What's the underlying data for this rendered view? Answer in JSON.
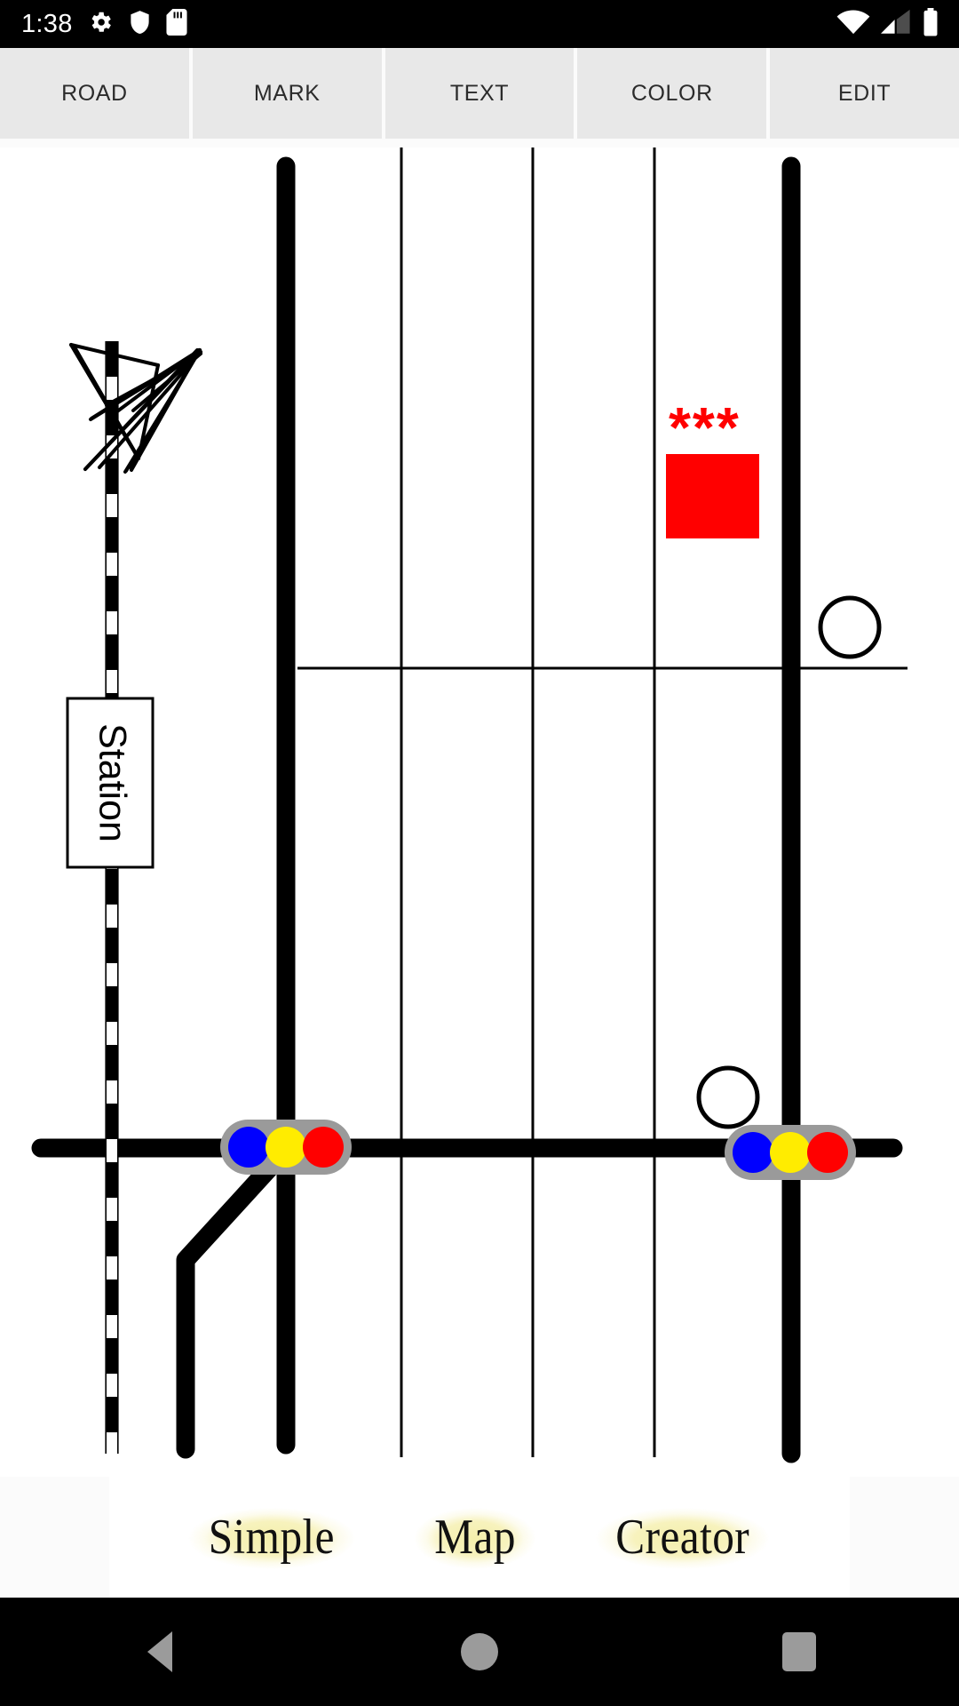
{
  "status_bar": {
    "time": "1:38",
    "left_icons": [
      "gear-icon",
      "shield-icon",
      "sd-card-icon"
    ],
    "right_icons": [
      "wifi-icon",
      "cellular-signal-icon",
      "battery-icon"
    ],
    "background_color": "#000000",
    "icon_color": "#ffffff"
  },
  "toolbar": {
    "buttons": [
      {
        "label": "ROAD"
      },
      {
        "label": "MARK"
      },
      {
        "label": "TEXT"
      },
      {
        "label": "COLOR"
      },
      {
        "label": "EDIT"
      }
    ],
    "button_background": "#e8e8e8",
    "button_text_color": "#2b2b2b"
  },
  "map": {
    "background_color": "#ffffff",
    "labels": [
      {
        "name": "station-label",
        "text": "Station",
        "rotation_deg": 90
      }
    ],
    "text_marks": [
      {
        "name": "asterisk-mark",
        "text": "***",
        "color": "#ff0000"
      }
    ],
    "shapes": [
      {
        "name": "red-building-block",
        "type": "rectangle",
        "color": "#ff0000"
      },
      {
        "name": "circle-mark-upper",
        "type": "circle",
        "stroke": "#000000",
        "fill": "none"
      },
      {
        "name": "circle-mark-lower",
        "type": "circle",
        "stroke": "#000000",
        "fill": "none"
      }
    ],
    "roads": {
      "major_color": "#000000",
      "minor_color": "#000000",
      "major_count": 3,
      "minor_count": 4
    },
    "railway": {
      "name": "railway-line",
      "style": "dashed",
      "colors": [
        "#000000",
        "#ffffff"
      ]
    },
    "traffic_lights": [
      {
        "name": "traffic-light-left",
        "lamps": [
          "#0000ff",
          "#ffec00",
          "#ff0000"
        ],
        "body_color": "#9a9a9a"
      },
      {
        "name": "traffic-light-right",
        "lamps": [
          "#0000ff",
          "#ffec00",
          "#ff0000"
        ],
        "body_color": "#9a9a9a"
      }
    ]
  },
  "logo": {
    "words": [
      "Simple",
      "Map",
      "Creator"
    ],
    "highlight_color": "#f4efac",
    "text_color": "#111111"
  },
  "nav_bar": {
    "buttons": [
      {
        "name": "back",
        "icon": "triangle-left-icon"
      },
      {
        "name": "home",
        "icon": "circle-icon"
      },
      {
        "name": "recents",
        "icon": "square-icon"
      }
    ],
    "background_color": "#000000",
    "icon_color": "#9b9b9b"
  }
}
